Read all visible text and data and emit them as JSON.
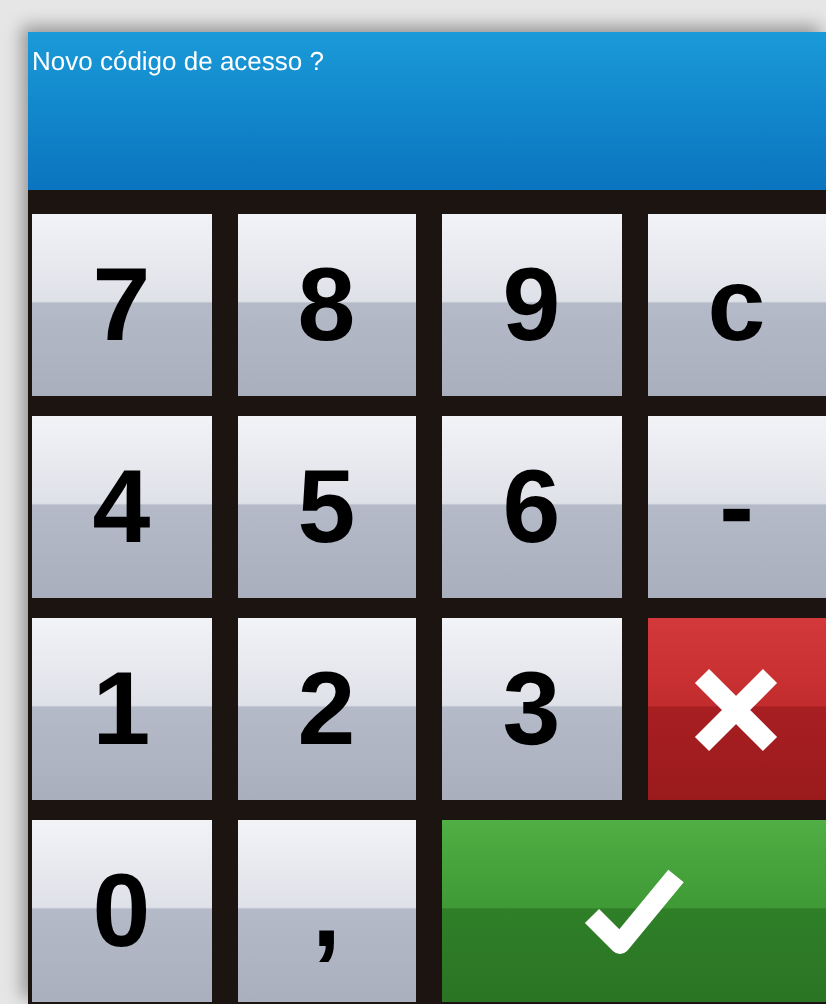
{
  "header": {
    "title": "Novo código de acesso ?"
  },
  "keys": [
    {
      "kind": "text",
      "label": "7"
    },
    {
      "kind": "text",
      "label": "8"
    },
    {
      "kind": "text",
      "label": "9"
    },
    {
      "kind": "text",
      "label": "c"
    },
    {
      "kind": "text",
      "label": "4"
    },
    {
      "kind": "text",
      "label": "5"
    },
    {
      "kind": "text",
      "label": "6"
    },
    {
      "kind": "text",
      "label": "-"
    },
    {
      "kind": "text",
      "label": "1"
    },
    {
      "kind": "text",
      "label": "2"
    },
    {
      "kind": "text",
      "label": "3"
    },
    {
      "kind": "cancel"
    },
    {
      "kind": "text",
      "label": "0"
    },
    {
      "kind": "text",
      "label": ","
    },
    {
      "kind": "confirm"
    }
  ]
}
